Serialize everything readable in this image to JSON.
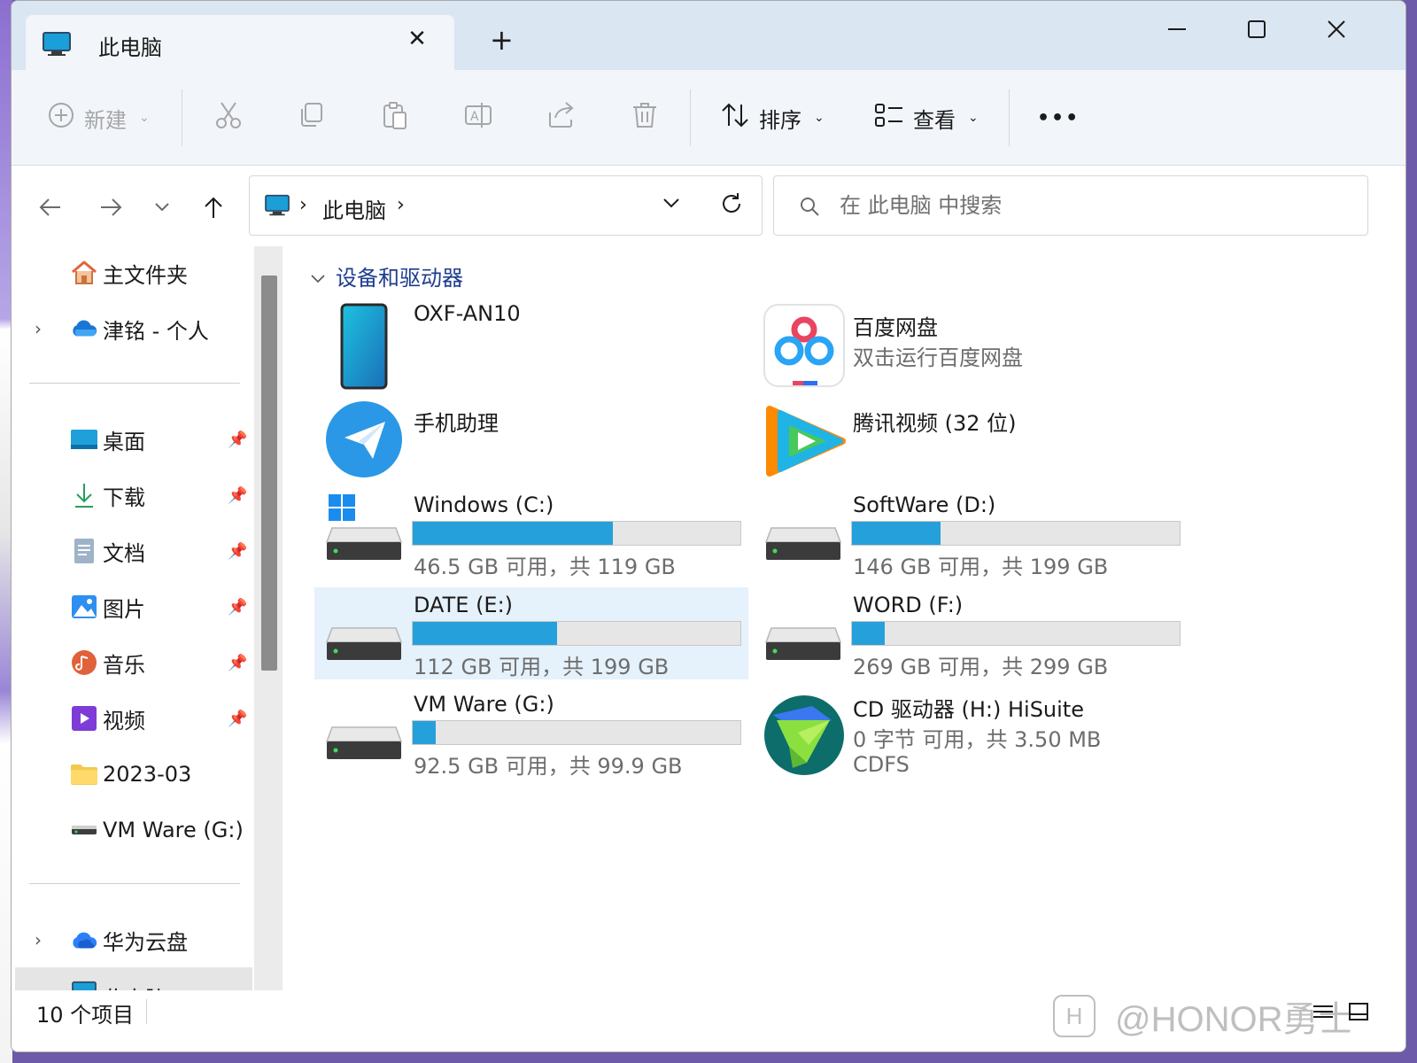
{
  "window": {
    "tab_title": "此电脑",
    "tab_close": "✕",
    "new_tab": "+"
  },
  "toolbar": {
    "new_label": "新建",
    "sort_label": "排序",
    "view_label": "查看",
    "more_label": "•••"
  },
  "nav": {
    "breadcrumb": [
      "此电脑"
    ],
    "search_placeholder": "在 此电脑 中搜索"
  },
  "sidebar": {
    "top": [
      {
        "label": "主文件夹",
        "icon": "home-icon"
      },
      {
        "label": "津铭 - 个人",
        "icon": "onedrive-icon"
      }
    ],
    "pinned": [
      {
        "label": "桌面",
        "icon": "desktop-icon",
        "pinned": true
      },
      {
        "label": "下载",
        "icon": "download-icon",
        "pinned": true
      },
      {
        "label": "文档",
        "icon": "documents-icon",
        "pinned": true
      },
      {
        "label": "图片",
        "icon": "pictures-icon",
        "pinned": true
      },
      {
        "label": "音乐",
        "icon": "music-icon",
        "pinned": true
      },
      {
        "label": "视频",
        "icon": "videos-icon",
        "pinned": true
      },
      {
        "label": "2023-03",
        "icon": "folder-icon",
        "pinned": false
      },
      {
        "label": "VM Ware (G:)",
        "icon": "drive-icon",
        "pinned": false
      }
    ],
    "bottom": [
      {
        "label": "华为云盘",
        "icon": "huawei-cloud-icon"
      },
      {
        "label": "此电脑",
        "icon": "this-pc-icon"
      }
    ]
  },
  "main": {
    "group_title": "设备和驱动器",
    "items": [
      {
        "name": "OXF-AN10",
        "icon": "phone-icon"
      },
      {
        "name": "百度网盘",
        "sub": "双击运行百度网盘",
        "icon": "baidu-netdisk-icon"
      },
      {
        "name": "手机助理",
        "icon": "phone-assistant-icon"
      },
      {
        "name": "腾讯视频 (32 位)",
        "icon": "tencent-video-icon"
      },
      {
        "name": "Windows (C:)",
        "sub": "46.5 GB 可用，共 119 GB",
        "used_fraction": 0.61,
        "icon": "system-drive-icon"
      },
      {
        "name": "SoftWare (D:)",
        "sub": "146 GB 可用，共 199 GB",
        "used_fraction": 0.27,
        "icon": "drive-icon"
      },
      {
        "name": "DATE (E:)",
        "sub": "112 GB 可用，共 199 GB",
        "used_fraction": 0.44,
        "icon": "drive-icon",
        "selected": true
      },
      {
        "name": "WORD (F:)",
        "sub": "269 GB 可用，共 299 GB",
        "used_fraction": 0.1,
        "icon": "drive-icon"
      },
      {
        "name": "VM Ware (G:)",
        "sub": "92.5 GB 可用，共 99.9 GB",
        "used_fraction": 0.07,
        "icon": "drive-icon"
      },
      {
        "name": "CD 驱动器 (H:) HiSuite",
        "sub": "0 字节 可用，共 3.50 MB",
        "sub2": "CDFS",
        "icon": "hisuite-cd-icon"
      }
    ]
  },
  "status": {
    "item_count": "10 个项目",
    "watermark": "@HONOR勇士",
    "watermark_logo": "H"
  },
  "colors": {
    "accent": "#26a0da",
    "titlebar": "#dbe6f3",
    "selection": "#e5f1fb",
    "group_header": "#1e3d8f"
  }
}
